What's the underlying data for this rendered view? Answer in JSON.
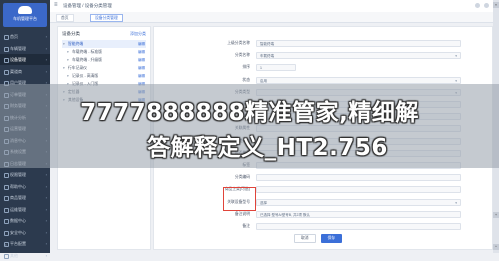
{
  "app": {
    "logo_text": "车机管理平台"
  },
  "sidebar": {
    "items": [
      {
        "label": "首页",
        "active": false
      },
      {
        "label": "车辆管理",
        "active": false
      },
      {
        "label": "设备管理",
        "active": true
      },
      {
        "label": "渠道商",
        "active": false
      },
      {
        "label": "用户管理",
        "active": false
      },
      {
        "label": "订单管理",
        "active": false
      },
      {
        "label": "财务管理",
        "active": false
      },
      {
        "label": "统计分析",
        "active": false
      },
      {
        "label": "运营管理",
        "active": false
      },
      {
        "label": "消息中心",
        "active": false
      },
      {
        "label": "系统设置",
        "active": false
      },
      {
        "label": "日志管理",
        "active": false
      },
      {
        "label": "权限管理",
        "active": false
      },
      {
        "label": "帮助中心",
        "active": false
      },
      {
        "label": "商品管理",
        "active": false
      },
      {
        "label": "运维管理",
        "active": false
      },
      {
        "label": "数据中心",
        "active": false
      },
      {
        "label": "安全中心",
        "active": false
      },
      {
        "label": "平台配置",
        "active": false
      },
      {
        "label": "其他",
        "active": false
      }
    ]
  },
  "topbar": {
    "title": "设备管理 / 设备分类管理"
  },
  "tabs": [
    {
      "label": "首页",
      "active": false
    },
    {
      "label": "设备分类管理",
      "active": true
    }
  ],
  "tree": {
    "title": "设备分类",
    "add_label": "添加分类",
    "edit_label": "编辑",
    "nodes": [
      {
        "label": "智能终端",
        "child": false,
        "selected": true
      },
      {
        "label": "车载终端 - 标准版",
        "child": true,
        "selected": false
      },
      {
        "label": "车载终端 - 升级版",
        "child": true,
        "selected": false
      },
      {
        "label": "行车记录仪",
        "child": false,
        "selected": false
      },
      {
        "label": "记录仪 - 高清版",
        "child": true,
        "selected": false
      },
      {
        "label": "记录仪 - 入门版",
        "child": true,
        "selected": false
      },
      {
        "label": "定位器",
        "child": false,
        "selected": false
      },
      {
        "label": "其他设备",
        "child": false,
        "selected": false
      }
    ]
  },
  "form": {
    "rows": [
      {
        "label": "上级分类名称",
        "value": "智能终端",
        "short": false,
        "select": false
      },
      {
        "label": "分类名称",
        "value": "车载终端",
        "short": false,
        "select": true
      },
      {
        "label": "排序",
        "value": "1",
        "short": true,
        "select": false
      },
      {
        "label": "状态",
        "value": "启用",
        "short": false,
        "select": true
      },
      {
        "label": "分类类型",
        "value": "",
        "short": false,
        "select": true
      },
      {
        "label": "图标",
        "value": "",
        "short": false,
        "select": false
      },
      {
        "label": "描述",
        "value": "",
        "short": false,
        "select": false
      },
      {
        "label": "关联属性",
        "value": "",
        "short": false,
        "select": false
      },
      {
        "label": "计费规则",
        "value": "",
        "short": false,
        "select": false
      },
      {
        "label": "是否推荐",
        "value": "",
        "short": false,
        "select": false
      },
      {
        "label": "标签",
        "value": "",
        "short": false,
        "select": false
      },
      {
        "label": "分类编码",
        "value": "",
        "short": false,
        "select": false
      },
      {
        "label": "商品上架(可选)",
        "value": "",
        "short": false,
        "select": false
      },
      {
        "label": "关联设备型号",
        "value": "选择",
        "short": false,
        "select": true
      },
      {
        "label": "备注说明",
        "value": "已选择 型号A/型号B, 共2项 默认",
        "short": false,
        "select": false
      },
      {
        "label": "备注",
        "value": "",
        "short": false,
        "select": false
      }
    ],
    "cancel_label": "取消",
    "save_label": "保存"
  },
  "banner": {
    "line1": "7777888888精准管家,精细解",
    "line2": "答解释定义_HT2.756"
  },
  "colors": {
    "accent": "#3b6fd8",
    "sidebar": "#2c3a4e",
    "highlight": "#e0443a"
  }
}
